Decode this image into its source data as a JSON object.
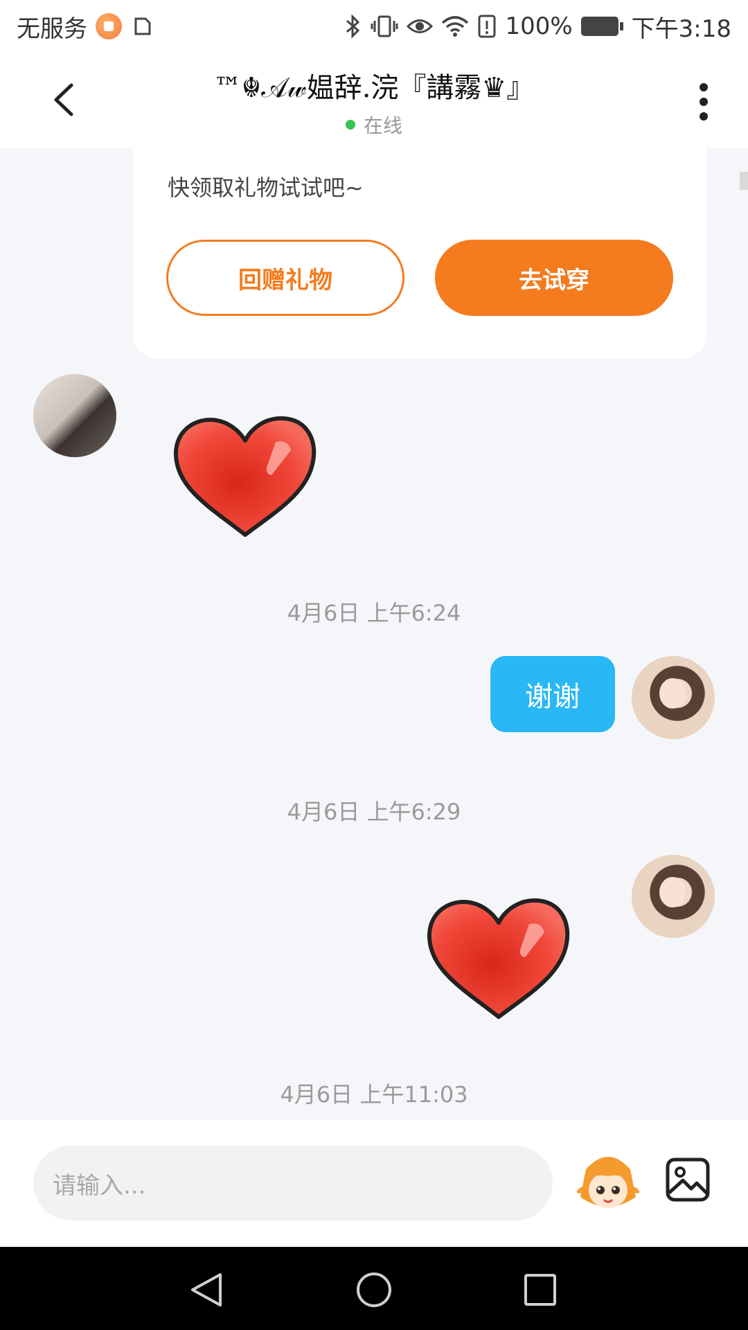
{
  "status_bar": {
    "carrier": "无服务",
    "battery": "100%",
    "time": "下午3:18",
    "icons": [
      "app-notification-icon",
      "sim-icon",
      "bluetooth-icon",
      "vibrate-icon",
      "eye-icon",
      "wifi-icon",
      "alert-icon",
      "battery-icon"
    ]
  },
  "header": {
    "title": "™☬𝒜𝓌媪辞.浣『講霧♛』",
    "status": "在线",
    "status_color": "#36c553"
  },
  "gift_card": {
    "text": "快领取礼物试试吧~",
    "return_gift": "回赠礼物",
    "try_on": "去试穿",
    "accent": "#f47b1e"
  },
  "messages": [
    {
      "type": "sticker",
      "direction": "in",
      "sticker": "red-heart"
    },
    {
      "type": "time",
      "text": "4月6日 上午6:24"
    },
    {
      "type": "text",
      "direction": "out",
      "text": "谢谢",
      "bubble_color": "#29b8f5"
    },
    {
      "type": "time",
      "text": "4月6日 上午6:29"
    },
    {
      "type": "sticker",
      "direction": "out",
      "sticker": "red-heart"
    },
    {
      "type": "time",
      "text": "4月6日 上午11:03"
    }
  ],
  "input": {
    "placeholder": "请输入..."
  }
}
